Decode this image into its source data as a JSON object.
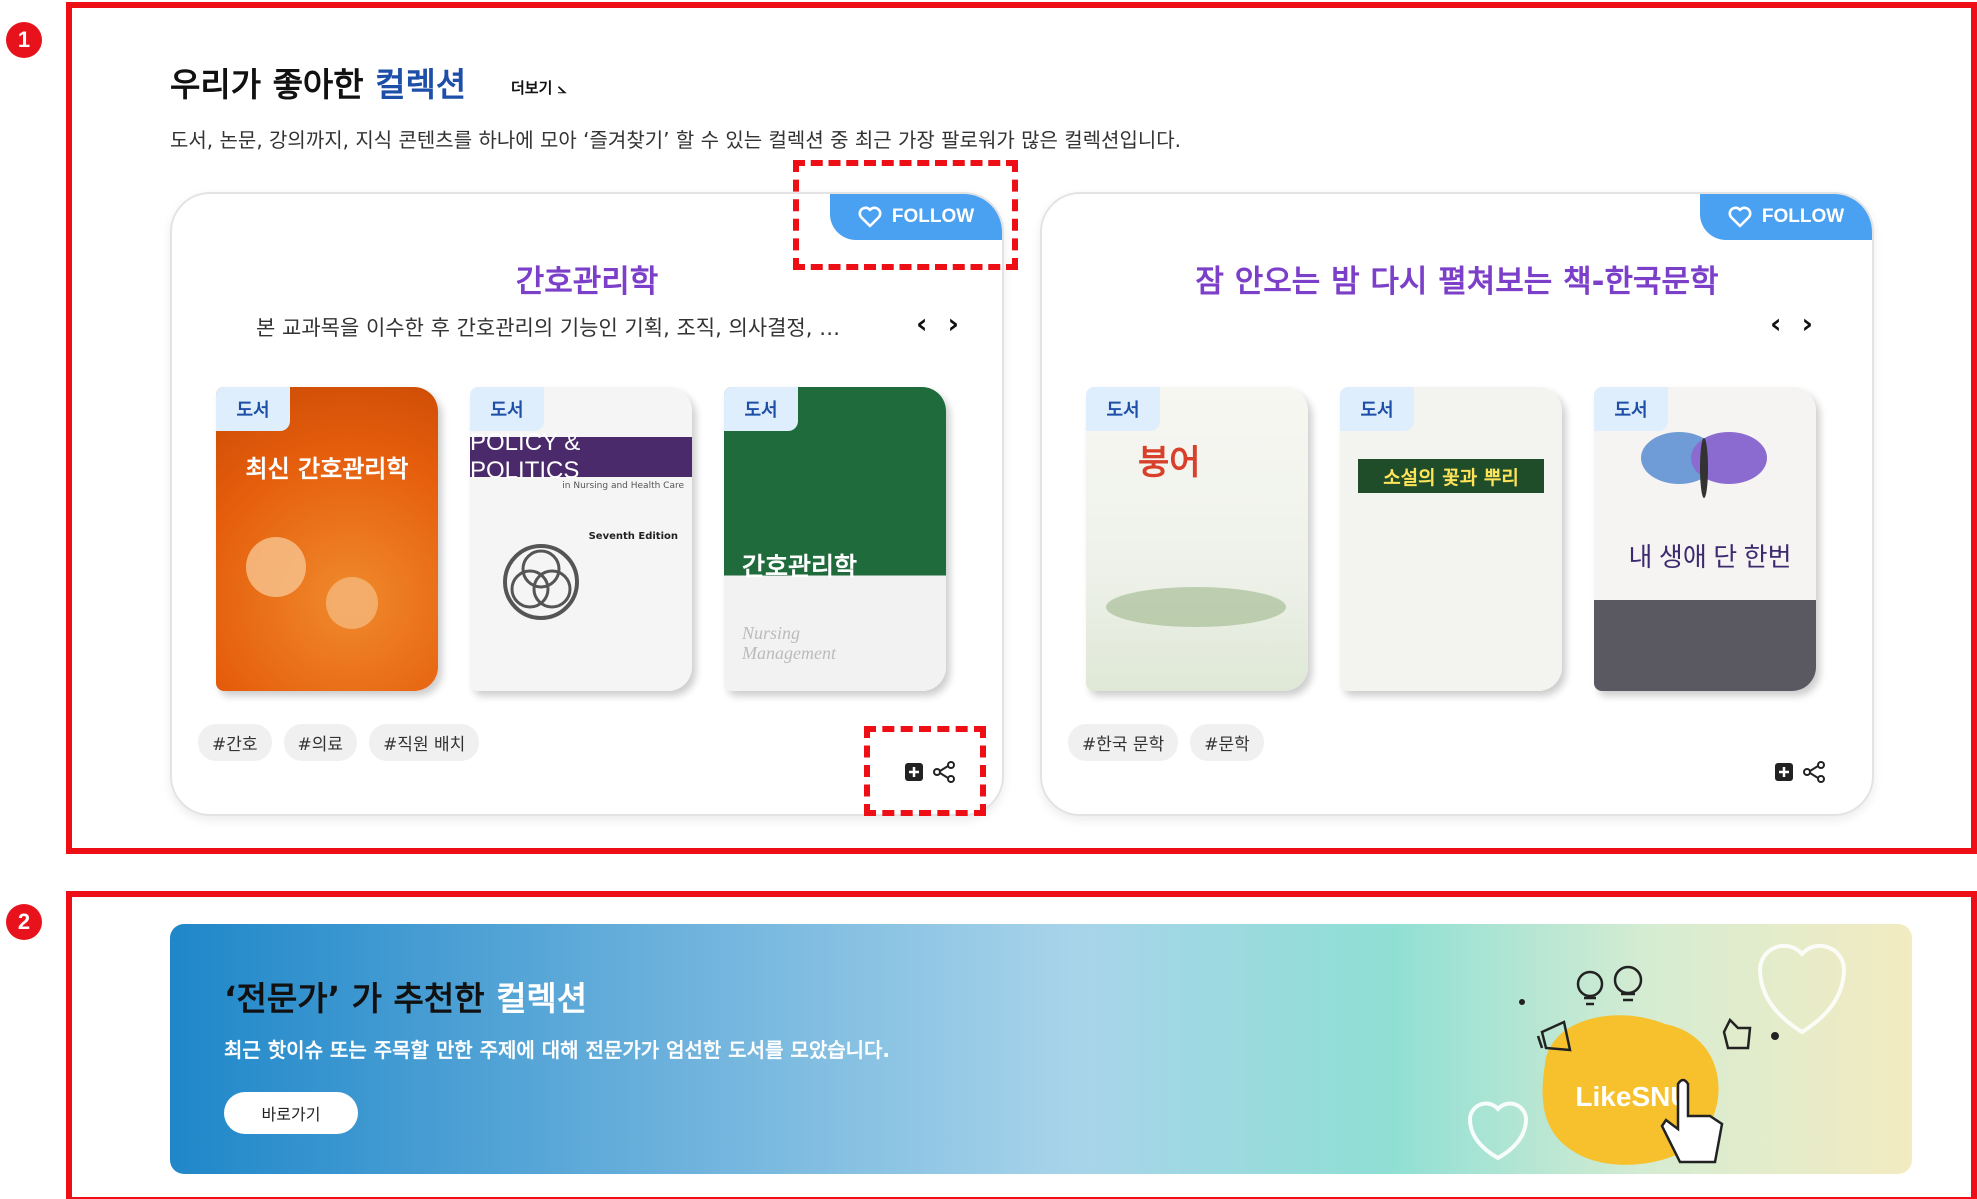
{
  "markers": [
    "1",
    "2"
  ],
  "section1": {
    "title_prefix": "우리가 좋아한 ",
    "title_accent": "컬렉션",
    "more_label": "더보기 ⦣",
    "description": "도서, 논문, 강의까지, 지식 콘텐츠를 하나에 모아 ‘즐겨찾기’ 할 수 있는 컬렉션 중 최근 가장 팔로워가 많은 컬렉션입니다."
  },
  "cards": [
    {
      "follow_label": "FOLLOW",
      "title": "간호관리학",
      "description": "본 교과목을 이수한 후 간호관리의 기능인 기획, 조직, 의사결정, 지…",
      "prev_icon": "‹",
      "next_icon": "›",
      "books": [
        {
          "tag": "도서",
          "cover_title": "최신 간호관리학"
        },
        {
          "tag": "도서",
          "cover_title": "POLICY & POLITICS",
          "cover_subtitle": "in Nursing and Health Care",
          "cover_edition": "Seventh Edition"
        },
        {
          "tag": "도서",
          "cover_title": "간호관리학",
          "cover_subtitle": "Nursing Management"
        }
      ],
      "hashtags": [
        "#간호",
        "#의료",
        "#직원 배치"
      ]
    },
    {
      "follow_label": "FOLLOW",
      "title": "잠 안오는 밤 다시 펼쳐보는 책-한국문학",
      "description": "",
      "prev_icon": "‹",
      "next_icon": "›",
      "books": [
        {
          "tag": "도서",
          "cover_title": "붕어"
        },
        {
          "tag": "도서",
          "cover_title": "소설의 꽃과 뿌리"
        },
        {
          "tag": "도서",
          "cover_title": "내 생애 단 한번"
        }
      ],
      "hashtags": [
        "#한국 문학",
        "#문학"
      ]
    }
  ],
  "section2": {
    "title_prefix": "‘전문가’ 가 추천한 ",
    "title_accent": "컬렉션",
    "description": "최근 핫이슈 또는 주목할 만한 주제에 대해 전문가가 엄선한 도서를 모았습니다.",
    "button_label": "바로가기",
    "logo_text": "LikeSNU"
  },
  "colors": {
    "annotation_red": "#ee0f16",
    "accent_blue": "#1e4fa8",
    "card_title_purple": "#7c3fc9",
    "follow_blue": "#4aa1f1",
    "tag_bg": "#dfeefc",
    "logo_yellow": "#f6c12c"
  },
  "icons": [
    "heart-icon",
    "chevron-left-icon",
    "chevron-right-icon",
    "add-box-icon",
    "share-icon",
    "bulb-icon",
    "megaphone-icon",
    "thumbs-up-icon",
    "pointer-hand-icon"
  ]
}
